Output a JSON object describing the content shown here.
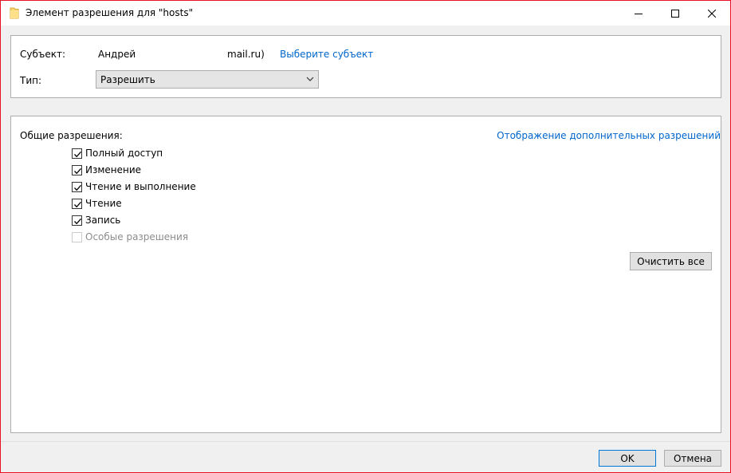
{
  "window": {
    "title": "Элемент разрешения для \"hosts\"",
    "accent_border": "#e81123"
  },
  "controls": {
    "minimize_icon": "minimize-icon",
    "maximize_icon": "maximize-icon",
    "close_icon": "close-icon"
  },
  "principal": {
    "label": "Субъект:",
    "name": "Андрей",
    "email_suffix": "mail.ru)",
    "select_link": "Выберите субъект"
  },
  "type": {
    "label": "Тип:",
    "selected": "Разрешить"
  },
  "permissions": {
    "header": "Общие разрешения:",
    "advanced_link": "Отображение дополнительных разрешений",
    "items": [
      {
        "label": "Полный доступ",
        "checked": true,
        "enabled": true
      },
      {
        "label": "Изменение",
        "checked": true,
        "enabled": true
      },
      {
        "label": "Чтение и выполнение",
        "checked": true,
        "enabled": true
      },
      {
        "label": "Чтение",
        "checked": true,
        "enabled": true
      },
      {
        "label": "Запись",
        "checked": true,
        "enabled": true
      },
      {
        "label": "Особые разрешения",
        "checked": false,
        "enabled": false
      }
    ],
    "clear_all": "Очистить все"
  },
  "footer": {
    "ok": "OK",
    "cancel": "Отмена"
  },
  "colors": {
    "link": "#0066cc",
    "default_button_border": "#0078d7"
  }
}
